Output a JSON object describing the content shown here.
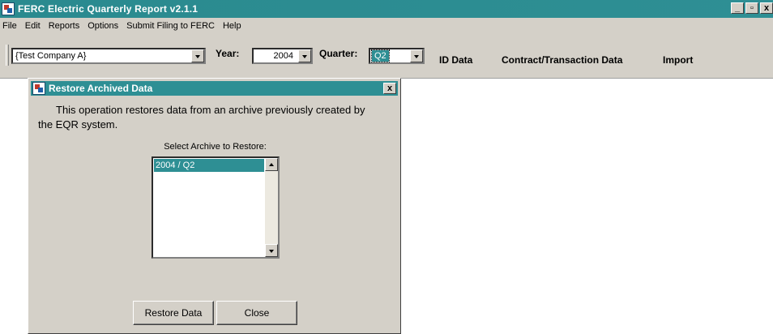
{
  "app": {
    "title": "FERC Electric Quarterly Report v2.1.1",
    "controls": {
      "minimize": "_",
      "restore": "🗗",
      "close": "✕"
    }
  },
  "menu": {
    "items": [
      "File",
      "Edit",
      "Reports",
      "Options",
      "Submit Filing to FERC",
      "Help"
    ]
  },
  "toolbar": {
    "company": "{Test Company A}",
    "year_label": "Year:",
    "year_value": "2004",
    "quarter_label": "Quarter:",
    "quarter_value": "Q2",
    "links": [
      "ID Data",
      "Contract/Transaction Data",
      "Import"
    ]
  },
  "dialog": {
    "title": "Restore Archived Data",
    "close": "✕",
    "description": "This operation restores data from an archive previously created by the EQR system.",
    "select_label": "Select Archive to Restore:",
    "archives": [
      "2004 / Q2"
    ],
    "buttons": {
      "restore": "Restore Data",
      "close": "Close"
    }
  },
  "colors": {
    "accent": "#2e8f94",
    "chrome": "#d4d0c8"
  }
}
